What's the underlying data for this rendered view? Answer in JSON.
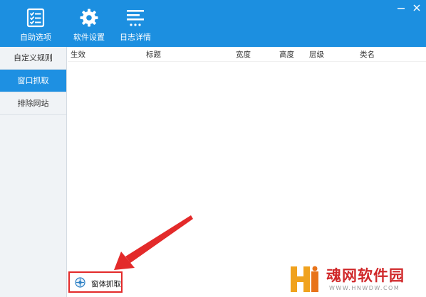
{
  "toolbar": {
    "items": [
      {
        "label": "自助选项",
        "icon": "checklist-icon"
      },
      {
        "label": "软件设置",
        "icon": "gear-icon"
      },
      {
        "label": "日志详情",
        "icon": "log-list-icon"
      }
    ]
  },
  "window_controls": {
    "minimize_icon": "minimize-icon",
    "close_icon": "close-icon"
  },
  "sidebar": {
    "items": [
      {
        "label": "自定义规则",
        "active": false
      },
      {
        "label": "窗口抓取",
        "active": true
      },
      {
        "label": "排除网站",
        "active": false
      }
    ]
  },
  "table": {
    "columns": [
      "生效",
      "标题",
      "宽度",
      "高度",
      "层级",
      "类名"
    ],
    "rows": []
  },
  "capture_button": {
    "label": "窗体抓取",
    "icon": "capture-icon"
  },
  "watermark": {
    "brand": "魂网软件园",
    "url": "WWW.HNWDW.COM"
  },
  "colors": {
    "header_bg": "#1c8fe0",
    "sidebar_active": "#1e90e2",
    "highlight_red": "#e32a2a",
    "watermark_red": "#d0282a"
  }
}
